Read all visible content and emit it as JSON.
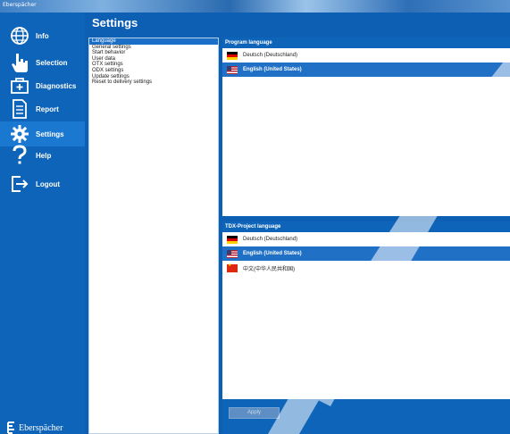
{
  "window": {
    "title": "Eberspächer"
  },
  "page_title": "Settings",
  "sidebar": {
    "items": [
      {
        "label": "Info",
        "icon": "globe-icon",
        "active": false
      },
      {
        "label": "Selection",
        "icon": "hand-pointer-icon",
        "active": false
      },
      {
        "label": "Diagnostics",
        "icon": "diagnostics-icon",
        "active": false
      },
      {
        "label": "Report",
        "icon": "report-icon",
        "active": false
      },
      {
        "label": "Settings",
        "icon": "gear-icon",
        "active": true
      },
      {
        "label": "Help",
        "icon": "question-icon",
        "active": false
      },
      {
        "label": "Logout",
        "icon": "logout-icon",
        "active": false
      }
    ],
    "brand": "Eberspächer"
  },
  "settings_list": {
    "items": [
      {
        "label": "Language",
        "selected": true
      },
      {
        "label": "General settings",
        "selected": false
      },
      {
        "label": "Start behavior",
        "selected": false
      },
      {
        "label": "User data",
        "selected": false
      },
      {
        "label": "OTX settings",
        "selected": false
      },
      {
        "label": "ODX settings",
        "selected": false
      },
      {
        "label": "Update settings",
        "selected": false
      },
      {
        "label": "Reset to delivery settings",
        "selected": false
      }
    ]
  },
  "program_language": {
    "header": "Program language",
    "options": [
      {
        "label": "Deutsch (Deutschland)",
        "flag": "de",
        "selected": false
      },
      {
        "label": "English (United States)",
        "flag": "us",
        "selected": true
      }
    ]
  },
  "tdx_language": {
    "header": "TDX-Project language",
    "options": [
      {
        "label": "Deutsch (Deutschland)",
        "flag": "de",
        "selected": false
      },
      {
        "label": "English (United States)",
        "flag": "us",
        "selected": true
      },
      {
        "label": "中文(中华人民共和国)",
        "flag": "cn",
        "selected": false
      }
    ]
  },
  "apply_button": {
    "label": "Apply"
  },
  "colors": {
    "sidebar": "#0e64b8",
    "selection": "#2070c6",
    "background": "#0d5fb3"
  }
}
